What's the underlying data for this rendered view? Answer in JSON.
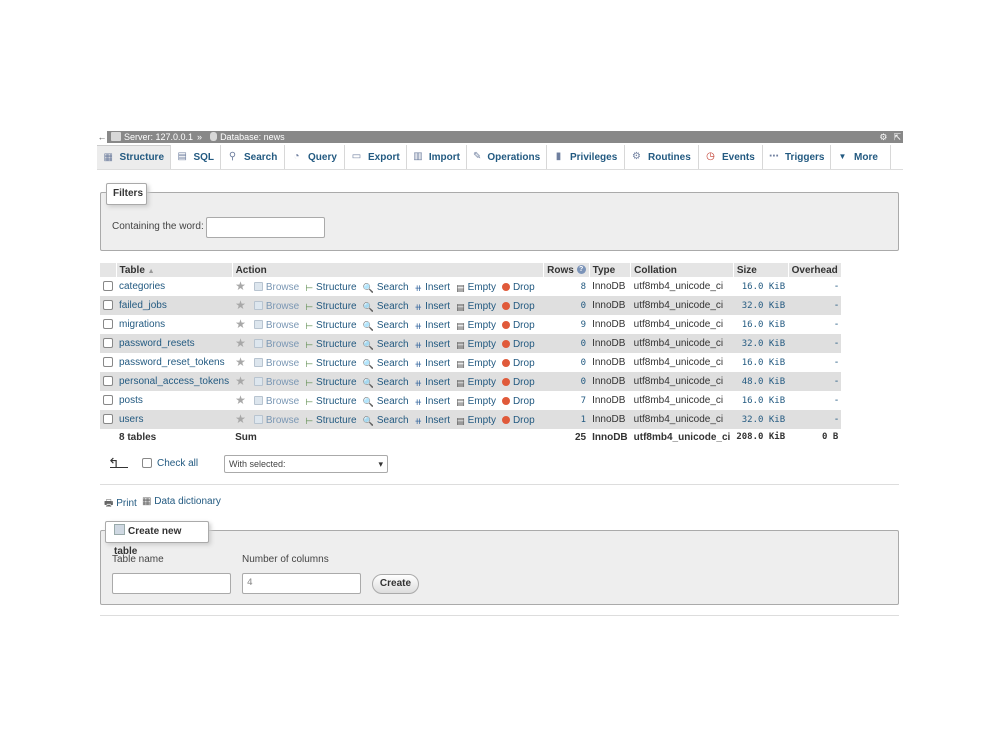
{
  "breadcrumb": {
    "server": "Server: 127.0.0.1",
    "separator": "»",
    "database": "Database: news"
  },
  "tabs": [
    {
      "label": "Structure",
      "icon": "structure-icon",
      "active": true
    },
    {
      "label": "SQL",
      "icon": "sql-icon"
    },
    {
      "label": "Search",
      "icon": "search-icon"
    },
    {
      "label": "Query",
      "icon": "query-icon"
    },
    {
      "label": "Export",
      "icon": "export-icon"
    },
    {
      "label": "Import",
      "icon": "import-icon"
    },
    {
      "label": "Operations",
      "icon": "operations-icon"
    },
    {
      "label": "Privileges",
      "icon": "privileges-icon"
    },
    {
      "label": "Routines",
      "icon": "routines-icon"
    },
    {
      "label": "Events",
      "icon": "events-icon"
    },
    {
      "label": "Triggers",
      "icon": "triggers-icon"
    },
    {
      "label": "More",
      "icon": "chevron-down-icon"
    }
  ],
  "filters": {
    "legend": "Filters",
    "containing_label": "Containing the word:",
    "containing_value": ""
  },
  "table": {
    "headers": {
      "table": "Table",
      "sort_indicator": "▲",
      "action": "Action",
      "rows": "Rows",
      "type": "Type",
      "collation": "Collation",
      "size": "Size",
      "overhead": "Overhead"
    },
    "actions": {
      "browse": "Browse",
      "structure": "Structure",
      "search": "Search",
      "insert": "Insert",
      "empty": "Empty",
      "drop": "Drop"
    },
    "rows": [
      {
        "name": "categories",
        "rows": "8",
        "type": "InnoDB",
        "collation": "utf8mb4_unicode_ci",
        "size": "16.0 KiB",
        "overhead": "-"
      },
      {
        "name": "failed_jobs",
        "rows": "0",
        "type": "InnoDB",
        "collation": "utf8mb4_unicode_ci",
        "size": "32.0 KiB",
        "overhead": "-"
      },
      {
        "name": "migrations",
        "rows": "9",
        "type": "InnoDB",
        "collation": "utf8mb4_unicode_ci",
        "size": "16.0 KiB",
        "overhead": "-"
      },
      {
        "name": "password_resets",
        "rows": "0",
        "type": "InnoDB",
        "collation": "utf8mb4_unicode_ci",
        "size": "32.0 KiB",
        "overhead": "-"
      },
      {
        "name": "password_reset_tokens",
        "rows": "0",
        "type": "InnoDB",
        "collation": "utf8mb4_unicode_ci",
        "size": "16.0 KiB",
        "overhead": "-"
      },
      {
        "name": "personal_access_tokens",
        "rows": "0",
        "type": "InnoDB",
        "collation": "utf8mb4_unicode_ci",
        "size": "48.0 KiB",
        "overhead": "-"
      },
      {
        "name": "posts",
        "rows": "7",
        "type": "InnoDB",
        "collation": "utf8mb4_unicode_ci",
        "size": "16.0 KiB",
        "overhead": "-"
      },
      {
        "name": "users",
        "rows": "1",
        "type": "InnoDB",
        "collation": "utf8mb4_unicode_ci",
        "size": "32.0 KiB",
        "overhead": "-"
      }
    ],
    "footer": {
      "count": "8 tables",
      "sum": "Sum",
      "rows": "25",
      "type": "InnoDB",
      "collation": "utf8mb4_unicode_ci",
      "size": "208.0 KiB",
      "overhead": "0 B"
    }
  },
  "bulk": {
    "check_all": "Check all",
    "with_selected": "With selected:"
  },
  "links": {
    "print": "Print",
    "data_dictionary": "Data dictionary"
  },
  "create_table": {
    "legend": "Create new table",
    "table_name_label": "Table name",
    "table_name_value": "",
    "columns_label": "Number of columns",
    "columns_value": "4",
    "create_button": "Create"
  }
}
